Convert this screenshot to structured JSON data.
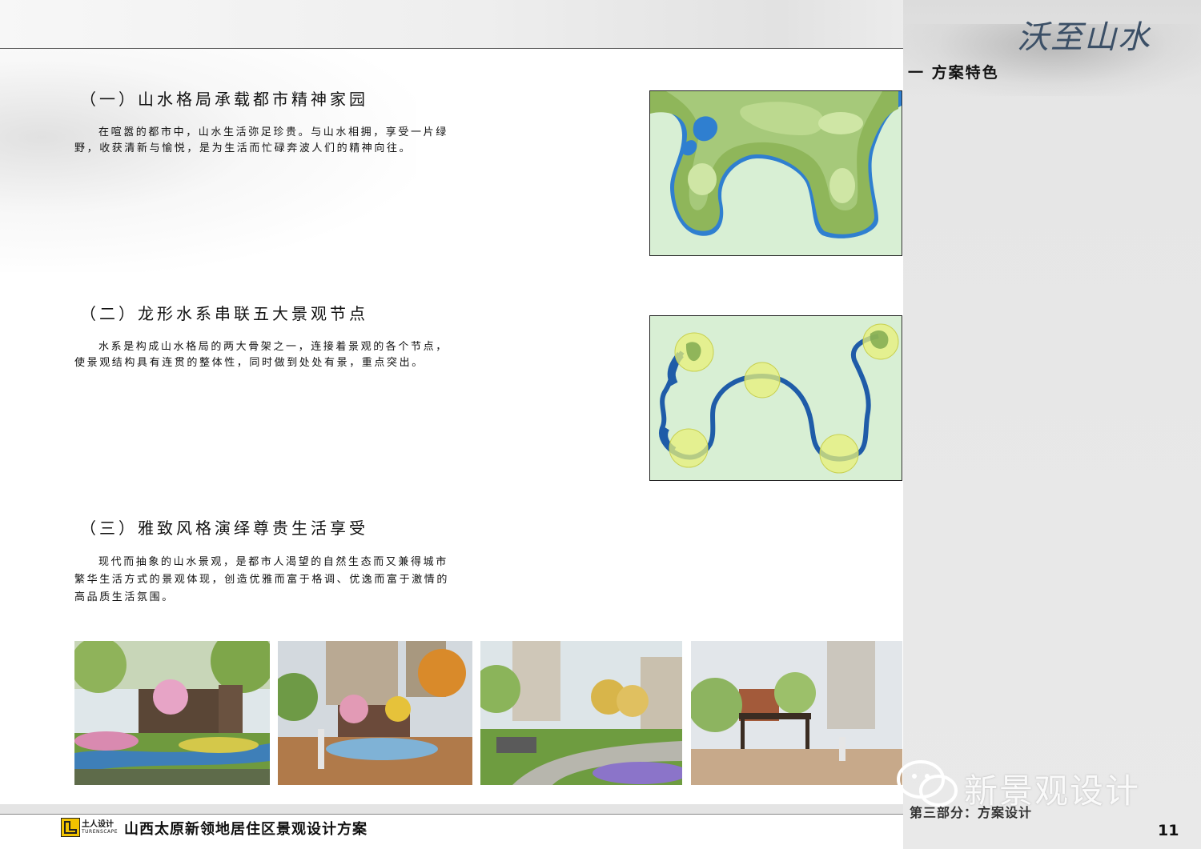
{
  "header": {
    "calligraphy_title": "沃至山水",
    "section_label": "一  方案特色"
  },
  "sections": [
    {
      "heading": "（一）山水格局承载都市精神家园",
      "lines": [
        "在喧嚣的都市中，山水生活弥足珍贵。与山水相拥，享受一片绿",
        "野，收获清新与愉悦，是为生活而忙碌奔波人们的精神向往。"
      ]
    },
    {
      "heading": "（二）龙形水系串联五大景观节点",
      "lines": [
        "水系是构成山水格局的两大骨架之一，连接着景观的各个节点，",
        "使景观结构具有连贯的整体性，同时做到处处有景，重点突出。"
      ]
    },
    {
      "heading": "（三）雅致风格演绎尊贵生活享受",
      "lines": [
        "现代而抽象的山水景观，是都市人渴望的自然生态而又兼得城市",
        "繁华生活方式的景观体现，创造优雅而富于格调、优逸而富于激情的",
        "高品质生活氛围。"
      ]
    }
  ],
  "footer": {
    "logo_cn": "土人设计",
    "logo_en": "TURENSCAPE",
    "project_title": "山西太原新领地居住区景观设计方案",
    "part_label": "第三部分：方案设计",
    "page_number": "11"
  },
  "watermark": {
    "text": "新景观设计"
  },
  "colors": {
    "water_blue": "#2f7fd0",
    "terrain_green": "#9cbf6a",
    "panel_gray": "#e8e8e8",
    "node_yellow": "#e8f07a"
  }
}
